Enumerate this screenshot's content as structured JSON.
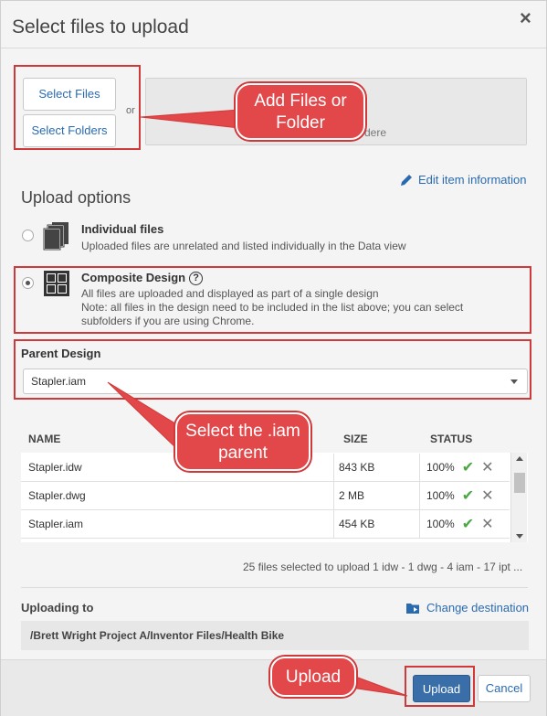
{
  "dialog": {
    "title": "Select files to upload",
    "close_label": "×"
  },
  "source": {
    "select_files_label": "Select Files",
    "select_folders_label": "Select Folders",
    "or_text": "or",
    "drop_hint": "dere"
  },
  "edit_item_label": "Edit item information",
  "upload_options": {
    "heading": "Upload options",
    "individual": {
      "title": "Individual files",
      "desc": "Uploaded files are unrelated and listed individually in the Data view",
      "selected": false
    },
    "composite": {
      "title": "Composite Design",
      "help": "?",
      "desc_1": "All files are uploaded and displayed as part of a single design",
      "desc_2": "Note: all files in the design need to be included in the list above; you can select",
      "desc_3": "subfolders if you are using Chrome.",
      "selected": true
    }
  },
  "parent_design": {
    "label": "Parent Design",
    "value": "Stapler.iam"
  },
  "file_table": {
    "headers": {
      "name": "NAME",
      "size": "SIZE",
      "status": "STATUS"
    },
    "rows": [
      {
        "name": "Stapler.idw",
        "size": "843 KB",
        "status": "100%"
      },
      {
        "name": "Stapler.dwg",
        "size": "2 MB",
        "status": "100%"
      },
      {
        "name": "Stapler.iam",
        "size": "454 KB",
        "status": "100%"
      }
    ],
    "summary": "25 files selected to upload  1 idw - 1 dwg - 4 iam - 17 ipt ..."
  },
  "destination": {
    "label": "Uploading to",
    "change_label": "Change destination",
    "path": "/Brett Wright Project A/Inventor Files/Health Bike"
  },
  "footer": {
    "upload_label": "Upload",
    "cancel_label": "Cancel"
  },
  "annotations": {
    "add_files": "Add Files or Folder",
    "select_iam": "Select the .iam parent",
    "upload": "Upload"
  },
  "colors": {
    "annotation_red": "#d0393a",
    "primary_button": "#3a6ea8",
    "link_blue": "#2a6bb0",
    "check_green": "#4aa842"
  }
}
